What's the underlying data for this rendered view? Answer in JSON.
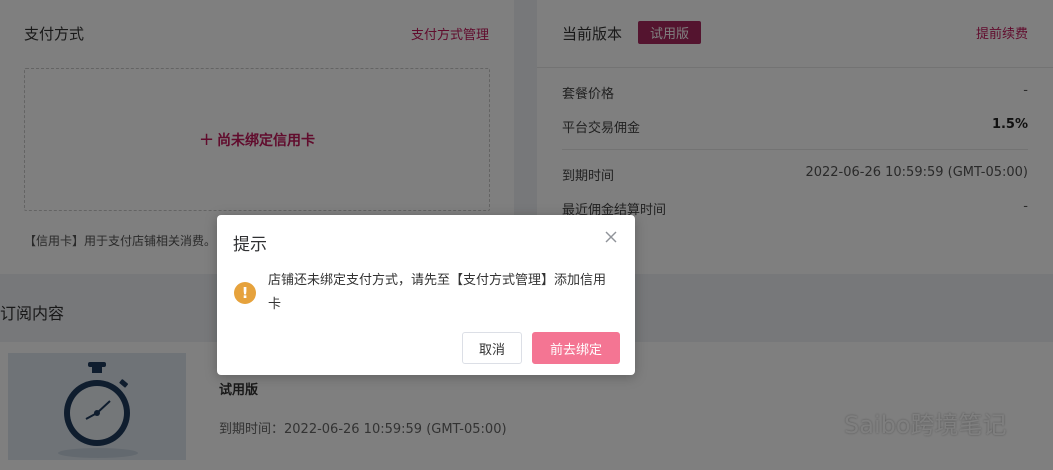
{
  "payment": {
    "title": "支付方式",
    "manage_link": "支付方式管理",
    "add_card_icon": "plus-icon",
    "add_card_label": "尚未绑定信用卡",
    "note": "【信用卡】用于支付店铺相关消费。"
  },
  "plan": {
    "title": "当前版本",
    "badge": "试用版",
    "renew_link": "提前续费",
    "rows": [
      {
        "label": "套餐价格",
        "value": "-"
      },
      {
        "label": "平台交易佣金",
        "value": "1.5%"
      },
      {
        "label": "到期时间",
        "value": "2022-06-26 10:59:59 (GMT-05:00)"
      },
      {
        "label": "最近佣金结算时间",
        "value": "-"
      }
    ]
  },
  "subscription": {
    "section_title": "订阅内容",
    "name": "试用版",
    "expire_label": "到期时间：2022-06-26 10:59:59 (GMT-05:00)",
    "thumb_icon": "stopwatch-icon"
  },
  "watermark": {
    "icon": "wechat-icon",
    "text": "Saibo跨境笔记"
  },
  "dialog": {
    "title": "提示",
    "message": "店铺还未绑定支付方式，请先至【支付方式管理】添加信用卡",
    "warn_icon": "warning-icon",
    "warn_glyph": "!",
    "cancel_label": "取消",
    "confirm_label": "前去绑定"
  },
  "colors": {
    "accent": "#c2185b",
    "badge": "#a8285f",
    "primary_button": "#f47593",
    "warning": "#e6a23c"
  }
}
